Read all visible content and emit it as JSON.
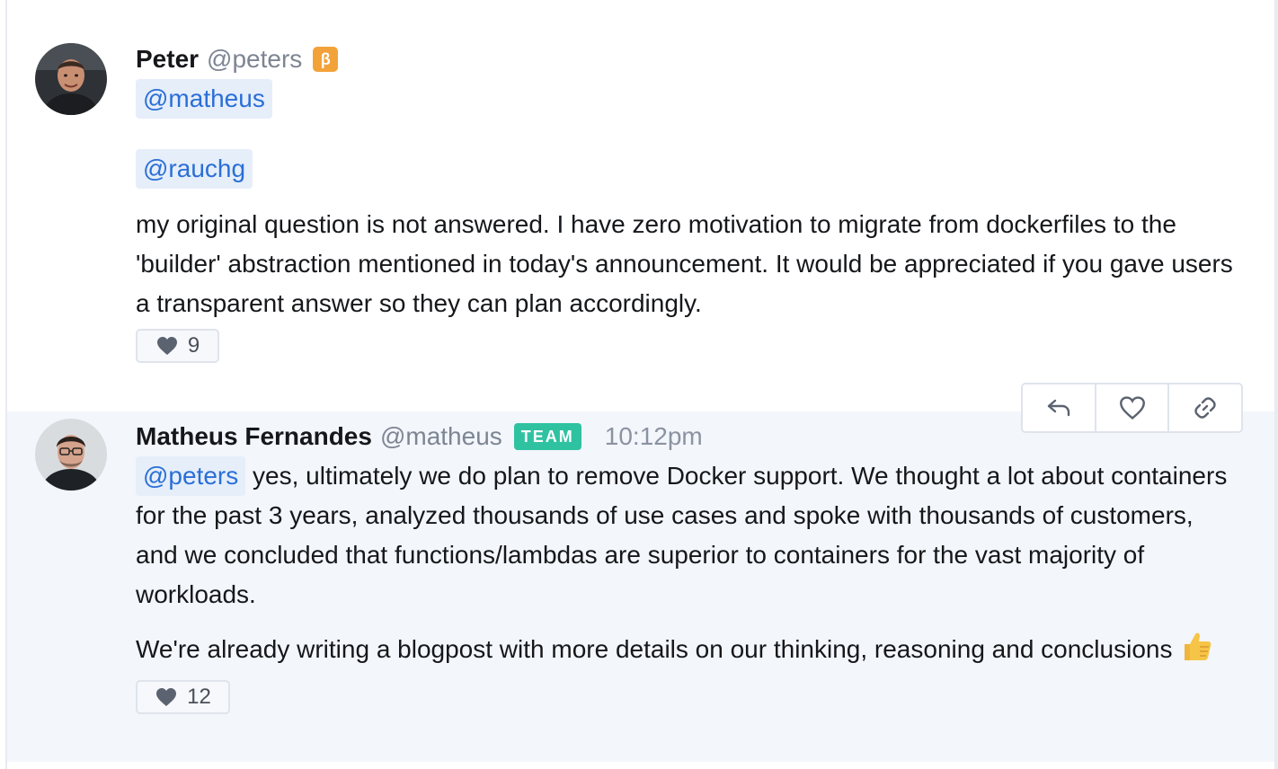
{
  "messages": [
    {
      "author_name": "Peter",
      "author_handle": "@peters",
      "badge": "β",
      "mentions": [
        "@matheus",
        "@rauchg"
      ],
      "text": "my original question is not answered. I have zero motivation to migrate from dockerfiles to the 'builder' abstraction mentioned in today's announcement. It would be appreciated if you gave users a transparent answer so they can plan accordingly.",
      "likes": "9"
    },
    {
      "author_name": "Matheus Fernandes",
      "author_handle": "@matheus",
      "badge": "TEAM",
      "time": "10:12pm",
      "mention": "@peters",
      "paragraph1": "yes, ultimately we do plan to remove Docker support. We thought a lot about containers for the past 3 years, analyzed thousands of use cases and spoke with thousands of customers, and we concluded that functions/lambdas are superior to containers for the vast majority of workloads.",
      "paragraph2": "We're already writing a blogpost with more details on our thinking, reasoning and conclusions",
      "emoji": "thumbs-up",
      "likes": "12"
    }
  ],
  "action_bar": [
    "reply-icon",
    "heart-icon",
    "link-icon"
  ],
  "colors": {
    "mention_bg": "#e6eefa",
    "mention_text": "#2a6fd6",
    "team_badge": "#2fc2a1",
    "beta_badge": "#f3a23a",
    "highlight_bg": "#f3f6fb"
  }
}
